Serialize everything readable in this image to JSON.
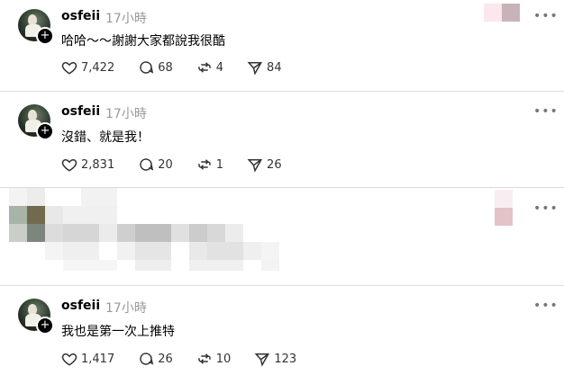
{
  "posts": [
    {
      "username": "osfeii",
      "time": "17小時",
      "text": "哈哈～～謝謝大家都說我很酷",
      "likes": "7,422",
      "comments": "68",
      "reposts": "4",
      "shares": "84"
    },
    {
      "username": "osfeii",
      "time": "17小時",
      "text": "沒錯、就是我！",
      "likes": "2,831",
      "comments": "20",
      "reposts": "1",
      "shares": "26"
    },
    {
      "username": "osfeii",
      "time": "17小時",
      "text": "我也是第一次上推特",
      "likes": "1,417",
      "comments": "26",
      "reposts": "10",
      "shares": "123"
    }
  ],
  "more_icon": "more-horizontal-icon",
  "colors": {
    "muted": "#999999",
    "separator": "#dbdbdb"
  }
}
